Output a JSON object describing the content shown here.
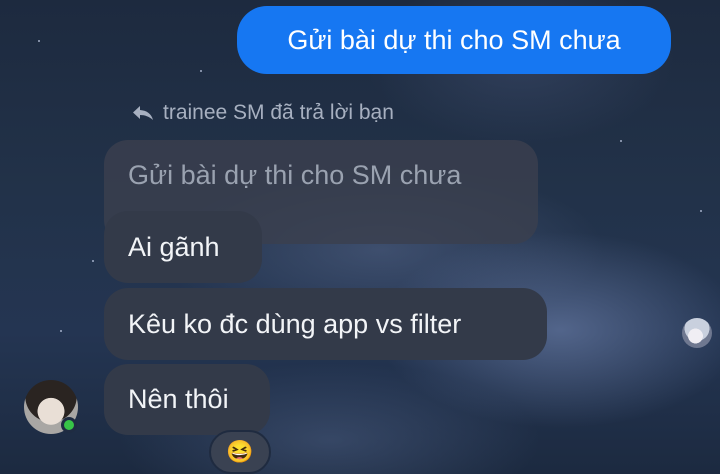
{
  "messages": {
    "sent": "Gửi bài dự thi cho SM chưa",
    "reply_context": "trainee SM đã trả lời bạn",
    "quoted": "Gửi bài dự thi cho SM chưa",
    "received": [
      "Ai gãnh",
      "Kêu ko đc dùng app vs filter",
      "Nên thôi"
    ]
  },
  "reaction": {
    "emoji": "😆"
  },
  "icons": {
    "reply": "reply-arrow-icon",
    "online": "online-status-dot",
    "avatar": "contact-avatar",
    "read_receipt": "read-receipt-avatar"
  },
  "colors": {
    "sent_bubble": "#1677f2",
    "received_bubble": "#333a49",
    "online": "#37c447"
  }
}
